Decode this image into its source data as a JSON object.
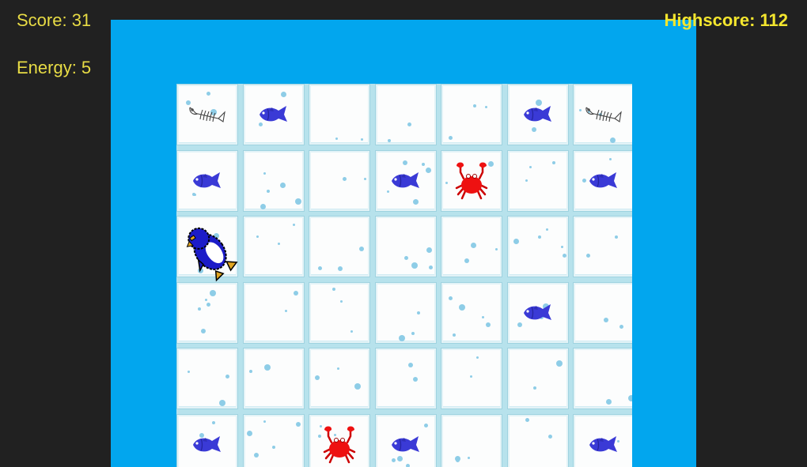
{
  "hud": {
    "score": "Score: 31",
    "energy": "Energy: 5",
    "highscore": "Highscore: 112"
  },
  "grid": {
    "columns": 7,
    "rows_visible": 6,
    "cells": [
      [
        "bones-icon",
        "fish-icon",
        "empty",
        "empty",
        "empty",
        "fish-icon",
        "bones-icon"
      ],
      [
        "fish-icon",
        "empty",
        "empty",
        "fish-icon",
        "crab-icon",
        "empty",
        "fish-icon"
      ],
      [
        "penguin-icon",
        "empty",
        "empty",
        "empty",
        "empty",
        "empty",
        "empty"
      ],
      [
        "empty",
        "empty",
        "empty",
        "empty",
        "empty",
        "fish-icon",
        "empty"
      ],
      [
        "empty",
        "empty",
        "empty",
        "empty",
        "empty",
        "empty",
        "empty"
      ],
      [
        "fish-icon",
        "empty",
        "crab-icon",
        "fish-icon",
        "empty",
        "empty",
        "fish-icon"
      ]
    ]
  },
  "colors": {
    "background": "#212121",
    "water": "#02a6ee",
    "ice_tile": "#fcfdfd",
    "tile_border": "#9fd3e0",
    "hud_text": "#e8dc45",
    "fish": "#3a3ad6",
    "crab": "#ee1111",
    "penguin": "#1c1cc8",
    "penguin_feet": "#e0a521"
  }
}
